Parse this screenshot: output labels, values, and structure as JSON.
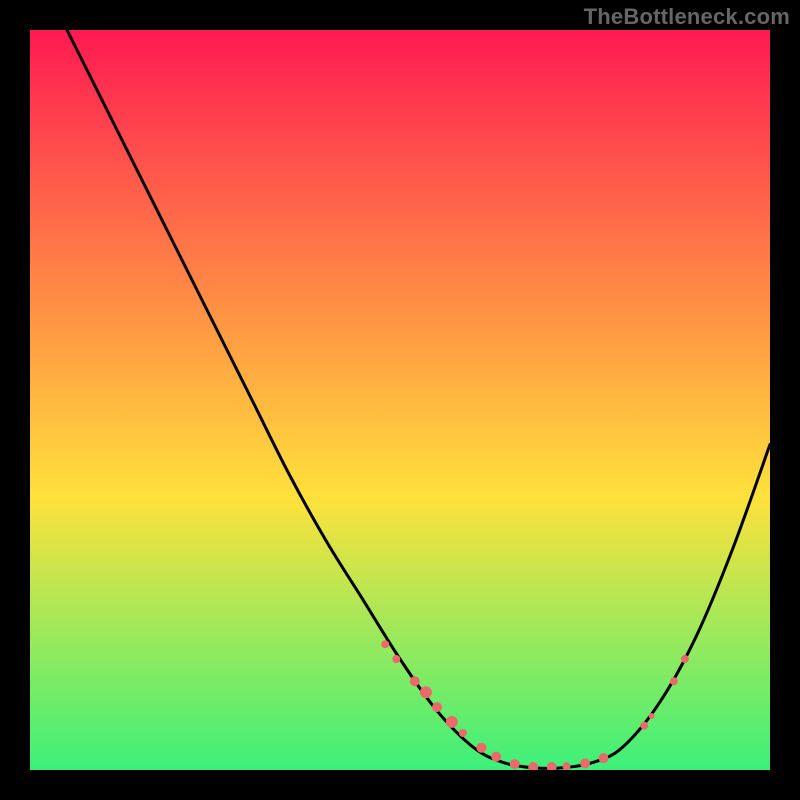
{
  "watermark": "TheBottleneck.com",
  "palette": {
    "gradient_top": "#ff1a52",
    "gradient_mid": "#ffe13b",
    "gradient_bot": "#3cf07a",
    "curve": "#000000",
    "dots": "#ea6a6a",
    "bg": "#000000"
  },
  "chart_data": {
    "type": "line",
    "title": "",
    "xlabel": "",
    "ylabel": "",
    "xlim": [
      0,
      100
    ],
    "ylim": [
      0,
      100
    ],
    "grid": false,
    "legend": false,
    "curve": [
      {
        "x": 5,
        "y": 100
      },
      {
        "x": 10,
        "y": 90
      },
      {
        "x": 15,
        "y": 80
      },
      {
        "x": 20,
        "y": 70
      },
      {
        "x": 25,
        "y": 60
      },
      {
        "x": 30,
        "y": 50
      },
      {
        "x": 35,
        "y": 40
      },
      {
        "x": 40,
        "y": 31
      },
      {
        "x": 45,
        "y": 23
      },
      {
        "x": 50,
        "y": 15
      },
      {
        "x": 55,
        "y": 8
      },
      {
        "x": 60,
        "y": 3
      },
      {
        "x": 64,
        "y": 1
      },
      {
        "x": 68,
        "y": 0.3
      },
      {
        "x": 72,
        "y": 0.3
      },
      {
        "x": 76,
        "y": 1
      },
      {
        "x": 80,
        "y": 3
      },
      {
        "x": 85,
        "y": 9
      },
      {
        "x": 90,
        "y": 18
      },
      {
        "x": 95,
        "y": 30
      },
      {
        "x": 100,
        "y": 44
      }
    ],
    "dots": [
      {
        "x": 48,
        "y": 17,
        "r": 4
      },
      {
        "x": 49.5,
        "y": 15,
        "r": 4
      },
      {
        "x": 52,
        "y": 12,
        "r": 5
      },
      {
        "x": 53.5,
        "y": 10.5,
        "r": 6
      },
      {
        "x": 55,
        "y": 8.5,
        "r": 5
      },
      {
        "x": 57,
        "y": 6.5,
        "r": 6
      },
      {
        "x": 58.5,
        "y": 5,
        "r": 4
      },
      {
        "x": 61,
        "y": 3,
        "r": 5
      },
      {
        "x": 63,
        "y": 1.8,
        "r": 5
      },
      {
        "x": 65.5,
        "y": 0.8,
        "r": 5
      },
      {
        "x": 68,
        "y": 0.4,
        "r": 5
      },
      {
        "x": 70.5,
        "y": 0.4,
        "r": 5
      },
      {
        "x": 72.5,
        "y": 0.5,
        "r": 4
      },
      {
        "x": 75,
        "y": 0.9,
        "r": 5
      },
      {
        "x": 77.5,
        "y": 1.6,
        "r": 5
      },
      {
        "x": 83,
        "y": 6,
        "r": 4
      },
      {
        "x": 84,
        "y": 7.3,
        "r": 3
      },
      {
        "x": 87,
        "y": 12,
        "r": 4
      },
      {
        "x": 88.5,
        "y": 15,
        "r": 4
      }
    ]
  }
}
